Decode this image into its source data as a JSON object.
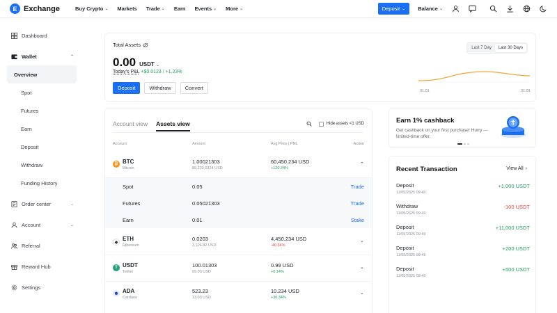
{
  "brand": {
    "name": "Exchange",
    "logo_letter": "E",
    "accent": "#1a6ff3"
  },
  "nav": [
    {
      "label": "Buy Crypto",
      "dropdown": true
    },
    {
      "label": "Markets",
      "dropdown": false
    },
    {
      "label": "Trade",
      "dropdown": true
    },
    {
      "label": "Earn",
      "dropdown": false
    },
    {
      "label": "Events",
      "dropdown": true
    },
    {
      "label": "More",
      "dropdown": true
    }
  ],
  "topright": {
    "deposit_label": "Deposit",
    "balance_label": "Balance"
  },
  "sidebar": {
    "dashboard": "Dashboard",
    "wallet": "Wallet",
    "wallet_items": [
      "Overview",
      "Spot",
      "Futures",
      "Earn",
      "Deposit",
      "Withdraw",
      "Funding History"
    ],
    "order_center": "Order center",
    "account": "Account",
    "referral": "Referral",
    "reward_hub": "Reward Hub",
    "settings": "Settings"
  },
  "assets": {
    "label": "Total Assets",
    "amount": "0.00",
    "currency": "USDT",
    "pnl_label": "Today's P&L",
    "pnl_value": "+$0.0123",
    "pnl_pct": "/ +1.23%",
    "buttons": {
      "deposit": "Deposit",
      "withdraw": "Withdraw",
      "convert": "Convert"
    },
    "range": {
      "seven": "Last 7 Day",
      "thirty": "Last 30 Days",
      "active": "thirty"
    },
    "chart_start": "01.01",
    "chart_end": "31.01"
  },
  "table": {
    "tabs": [
      "Account view",
      "Assets view"
    ],
    "active_tab": 1,
    "hide_label": "Hide assets <1 USD",
    "headers": {
      "account": "Account",
      "amount": "Amount",
      "avg": "Avg Price | PNL",
      "action": "Action"
    },
    "btc": {
      "symbol": "BTC",
      "name": "Bitcoin",
      "amount": "1.00021303",
      "usd": "89,223.0324  USD",
      "avg": "60,450.234 USD",
      "pnl": "+120.34%"
    },
    "btc_sub": [
      {
        "label": "Spot",
        "amount": "0.05",
        "action": "Trade"
      },
      {
        "label": "Futures",
        "amount": "0.05021303",
        "action": "Trade"
      },
      {
        "label": "Earn",
        "amount": "0.01",
        "action": "Stake"
      }
    ],
    "eth": {
      "symbol": "ETH",
      "name": "Ethereum",
      "amount": "0.0203",
      "usd": "3,124.82  USD",
      "avg": "4,450.234 USD",
      "pnl": "-40.34%"
    },
    "usdt": {
      "symbol": "USDT",
      "name": "Tether",
      "amount": "100.01303",
      "usd": "99.03  USD",
      "avg": "0.99 USD",
      "pnl": "+0.14%"
    },
    "ada": {
      "symbol": "ADA",
      "name": "Cardano",
      "amount": "523.23",
      "usd": "13.03  USD",
      "avg": "10.234 USD",
      "pnl": "+30.34%"
    }
  },
  "cashback": {
    "title": "Earn 1% cashback",
    "desc": "Get cashback on your first purchase! Hurry — limited-time offer."
  },
  "transactions": {
    "title": "Recent Transaction",
    "view_all": "View All",
    "items": [
      {
        "type": "Deposit",
        "date": "11/05/2025 09:49",
        "amount": "+1,000  USDT",
        "dir": "up"
      },
      {
        "type": "Withdraw",
        "date": "11/05/2025 09:49",
        "amount": "-100  USDT",
        "dir": "dn"
      },
      {
        "type": "Deposit",
        "date": "11/05/2025 09:49",
        "amount": "+11,000  USDT",
        "dir": "up"
      },
      {
        "type": "Deposit",
        "date": "11/05/2025 09:49",
        "amount": "+200  USDT",
        "dir": "up"
      },
      {
        "type": "Deposit",
        "date": "11/05/2025 09:49",
        "amount": "+500  USDT",
        "dir": "up"
      }
    ]
  }
}
